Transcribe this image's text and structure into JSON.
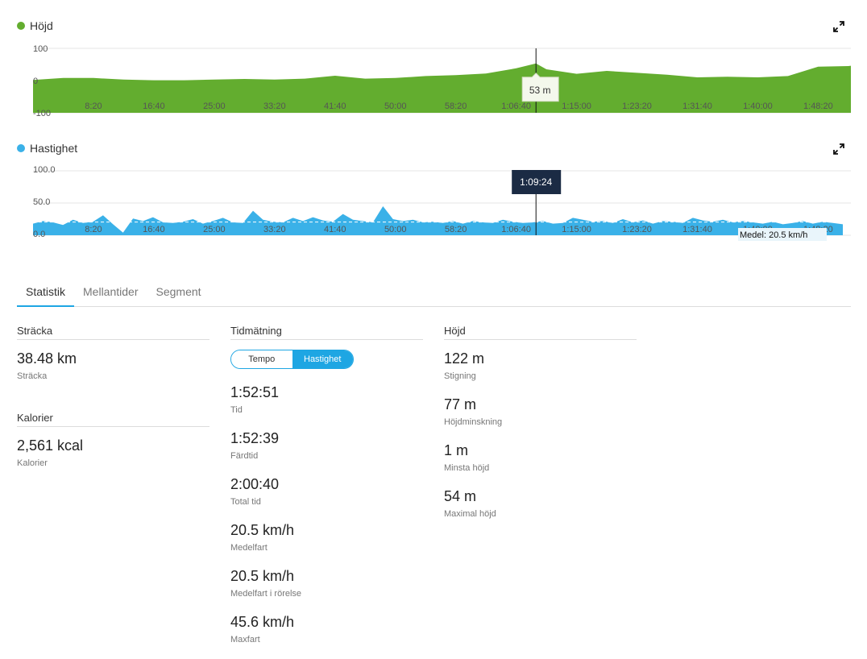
{
  "charts": [
    {
      "title": "Höjd",
      "color": "#63ad2f",
      "icon": "expand-icon",
      "yticks": [
        "100",
        "0",
        "-100"
      ],
      "xticks": [
        "8:20",
        "16:40",
        "25:00",
        "33:20",
        "41:40",
        "50:00",
        "58:20",
        "1:06:40",
        "1:15:00",
        "1:23:20",
        "1:31:40",
        "1:40:00",
        "1:48:20"
      ],
      "tooltip": "53 m"
    },
    {
      "title": "Hastighet",
      "color": "#3ab1e8",
      "icon": "expand-icon",
      "yticks": [
        "100.0",
        "50.0",
        "0.0"
      ],
      "xticks": [
        "8:20",
        "16:40",
        "25:00",
        "33:20",
        "41:40",
        "50:00",
        "58:20",
        "1:06:40",
        "1:15:00",
        "1:23:20",
        "1:31:40",
        "1:40:00",
        "1:48:20"
      ],
      "tooltip": "1:09:24",
      "average_label": "Medel: 20.5 km/h"
    }
  ],
  "chart_data": [
    {
      "type": "area",
      "title": "Höjd",
      "x_unit": "time",
      "x": [
        "0:00",
        "4:10",
        "8:20",
        "12:30",
        "16:40",
        "20:50",
        "25:00",
        "29:10",
        "33:20",
        "37:30",
        "41:40",
        "45:50",
        "50:00",
        "54:10",
        "58:20",
        "1:02:30",
        "1:06:40",
        "1:09:24",
        "1:10:50",
        "1:15:00",
        "1:19:10",
        "1:23:20",
        "1:27:30",
        "1:31:40",
        "1:35:50",
        "1:40:00",
        "1:44:10",
        "1:48:20",
        "1:52:30",
        "1:52:51"
      ],
      "y": [
        2,
        8,
        8,
        3,
        1,
        1,
        3,
        5,
        3,
        6,
        15,
        6,
        8,
        14,
        17,
        22,
        38,
        53,
        35,
        21,
        30,
        24,
        18,
        10,
        12,
        10,
        14,
        43,
        45,
        46
      ],
      "yticks": [
        -100,
        0,
        100
      ],
      "ylim": [
        -100,
        100
      ],
      "grid": true
    },
    {
      "type": "area",
      "title": "Hastighet",
      "x_unit": "time",
      "x_max": "1:52:51",
      "y": [
        18,
        22,
        20,
        16,
        24,
        19,
        21,
        31,
        17,
        4,
        26,
        22,
        28,
        20,
        19,
        21,
        25,
        18,
        22,
        27,
        20,
        19,
        38,
        24,
        21,
        20,
        27,
        22,
        28,
        23,
        21,
        33,
        24,
        22,
        20,
        45,
        25,
        22,
        24,
        20,
        21,
        19,
        22,
        18,
        22,
        20,
        19,
        24,
        21,
        19,
        20,
        22,
        18,
        19,
        27,
        24,
        21,
        22,
        19,
        25,
        20,
        23,
        18,
        22,
        21,
        19,
        27,
        23,
        21,
        24,
        20,
        22,
        20,
        18,
        21,
        17,
        19,
        22,
        18,
        21,
        19,
        17
      ],
      "average": 20.5,
      "yticks": [
        0,
        50,
        100
      ],
      "ylim": [
        0,
        100
      ],
      "grid": true
    }
  ],
  "tabs": [
    "Statistik",
    "Mellantider",
    "Segment"
  ],
  "stats": {
    "col1": [
      {
        "title": "Sträcka",
        "items": [
          {
            "value": "38.48 km",
            "label": "Sträcka"
          }
        ]
      },
      {
        "title": "Kalorier",
        "items": [
          {
            "value": "2,561 kcal",
            "label": "Kalorier"
          }
        ]
      }
    ],
    "col2": {
      "title": "Tidmätning",
      "toggle": [
        "Tempo",
        "Hastighet"
      ],
      "items": [
        {
          "value": "1:52:51",
          "label": "Tid"
        },
        {
          "value": "1:52:39",
          "label": "Färdtid"
        },
        {
          "value": "2:00:40",
          "label": "Total tid"
        },
        {
          "value": "20.5 km/h",
          "label": "Medelfart"
        },
        {
          "value": "20.5 km/h",
          "label": "Medelfart i rörelse"
        },
        {
          "value": "45.6 km/h",
          "label": "Maxfart"
        }
      ]
    },
    "col3": {
      "title": "Höjd",
      "items": [
        {
          "value": "122 m",
          "label": "Stigning"
        },
        {
          "value": "77 m",
          "label": "Höjdminskning"
        },
        {
          "value": "1 m",
          "label": "Minsta höjd"
        },
        {
          "value": "54 m",
          "label": "Maximal höjd"
        }
      ]
    }
  }
}
